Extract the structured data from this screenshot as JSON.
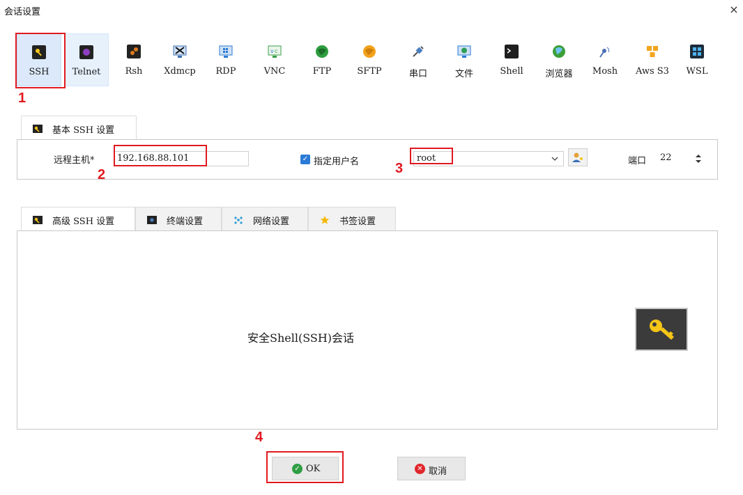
{
  "window": {
    "title": "会话设置",
    "close_glyph": "×"
  },
  "session_types": [
    {
      "label": "SSH",
      "icon": "ssh-key-icon",
      "color": "#1e1e1e"
    },
    {
      "label": "Telnet",
      "icon": "telnet-icon",
      "color": "#8e3fbf"
    },
    {
      "label": "Rsh",
      "icon": "rsh-icon",
      "color": "#c86a10"
    },
    {
      "label": "Xdmcp",
      "icon": "xdmcp-monitor-icon",
      "color": "#3b6fb0"
    },
    {
      "label": "RDP",
      "icon": "rdp-monitor-icon",
      "color": "#2b7bd6"
    },
    {
      "label": "VNC",
      "icon": "vnc-monitor-icon",
      "color": "#3a9f4b"
    },
    {
      "label": "FTP",
      "icon": "ftp-globe-icon",
      "color": "#2e9e3e"
    },
    {
      "label": "SFTP",
      "icon": "sftp-globe-icon",
      "color": "#f2a21b"
    },
    {
      "label": "串口",
      "icon": "serial-plug-icon",
      "color": "#4a7fc1"
    },
    {
      "label": "文件",
      "icon": "file-monitor-icon",
      "color": "#2f9e57"
    },
    {
      "label": "Shell",
      "icon": "shell-terminal-icon",
      "color": "#1e1e1e"
    },
    {
      "label": "浏览器",
      "icon": "browser-globe-icon",
      "color": "#3d9f3a"
    },
    {
      "label": "Mosh",
      "icon": "mosh-antenna-icon",
      "color": "#4a6fb5"
    },
    {
      "label": "Aws S3",
      "icon": "aws-cubes-icon",
      "color": "#f3a51f"
    },
    {
      "label": "WSL",
      "icon": "wsl-windows-icon",
      "color": "#1d2c3c"
    }
  ],
  "annotations": {
    "n1": "1",
    "n2": "2",
    "n3": "3",
    "n4": "4"
  },
  "basic_tab": {
    "label": "基本 SSH 设置",
    "icon": "ssh-key-icon"
  },
  "basic": {
    "remote_host_label": "远程主机*",
    "remote_host_value": "192.168.88.101",
    "specify_username_label": "指定用户名",
    "specify_username_checked": true,
    "username_value": "root",
    "port_label": "端口",
    "port_value": "22"
  },
  "adv_tabs": [
    {
      "label": "高级 SSH 设置",
      "icon": "ssh-key-icon"
    },
    {
      "label": "终端设置",
      "icon": "terminal-settings-icon"
    },
    {
      "label": "网络设置",
      "icon": "network-icon"
    },
    {
      "label": "书签设置",
      "icon": "bookmark-star-icon"
    }
  ],
  "adv_panel": {
    "caption": "安全Shell(SSH)会话"
  },
  "buttons": {
    "ok_label": "OK",
    "cancel_label": "取消"
  },
  "colors": {
    "accent": "#2b7bd6",
    "selected_bg": "#dbe9fa",
    "annotation_red": "#e0191f",
    "ok_green": "#2f9e43",
    "cancel_red": "#e0262c"
  }
}
